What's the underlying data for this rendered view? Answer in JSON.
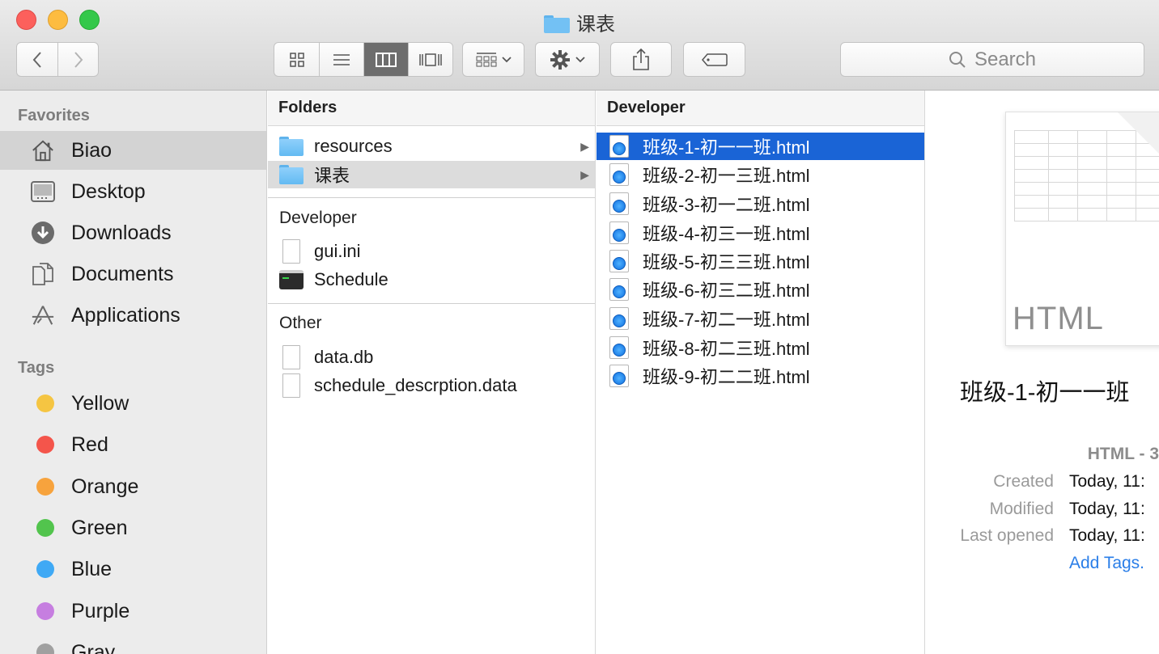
{
  "window": {
    "title": "课表"
  },
  "toolbar": {
    "back_icon": "chevron-left",
    "forward_icon": "chevron-right",
    "search_placeholder": "Search"
  },
  "sidebar": {
    "favorites_header": "Favorites",
    "favorites": [
      {
        "label": "Biao",
        "icon": "home-icon",
        "selected": true
      },
      {
        "label": "Desktop",
        "icon": "desktop-icon"
      },
      {
        "label": "Downloads",
        "icon": "downloads-icon"
      },
      {
        "label": "Documents",
        "icon": "documents-icon"
      },
      {
        "label": "Applications",
        "icon": "applications-icon"
      }
    ],
    "tags_header": "Tags",
    "tags": [
      {
        "label": "Yellow",
        "color": "#f5c542"
      },
      {
        "label": "Red",
        "color": "#f4554b"
      },
      {
        "label": "Orange",
        "color": "#f7a33d"
      },
      {
        "label": "Green",
        "color": "#52c44d"
      },
      {
        "label": "Blue",
        "color": "#3fa9f5"
      },
      {
        "label": "Purple",
        "color": "#c67ee0"
      },
      {
        "label": "Gray",
        "color": "#a0a0a0"
      }
    ]
  },
  "column_folders": {
    "header": "Folders",
    "folders": [
      "resources",
      "课表"
    ],
    "developer_header": "Developer",
    "developer_items": [
      "gui.ini",
      "Schedule"
    ],
    "other_header": "Other",
    "other_items": [
      "data.db",
      "schedule_descrption.data"
    ]
  },
  "column_developer": {
    "header": "Developer",
    "files": [
      "班级-1-初一一班.html",
      "班级-2-初一三班.html",
      "班级-3-初一二班.html",
      "班级-4-初三一班.html",
      "班级-5-初三三班.html",
      "班级-6-初三二班.html",
      "班级-7-初二一班.html",
      "班级-8-初二三班.html",
      "班级-9-初二二班.html"
    ]
  },
  "preview": {
    "thumbnail_caption": "HTML",
    "name": "班级-1-初一一班",
    "kind": "HTML - 3",
    "created_label": "Created",
    "created_value": "Today, 11:",
    "modified_label": "Modified",
    "modified_value": "Today, 11:",
    "last_opened_label": "Last opened",
    "last_opened_value": "Today, 11:",
    "add_tags": "Add Tags."
  }
}
